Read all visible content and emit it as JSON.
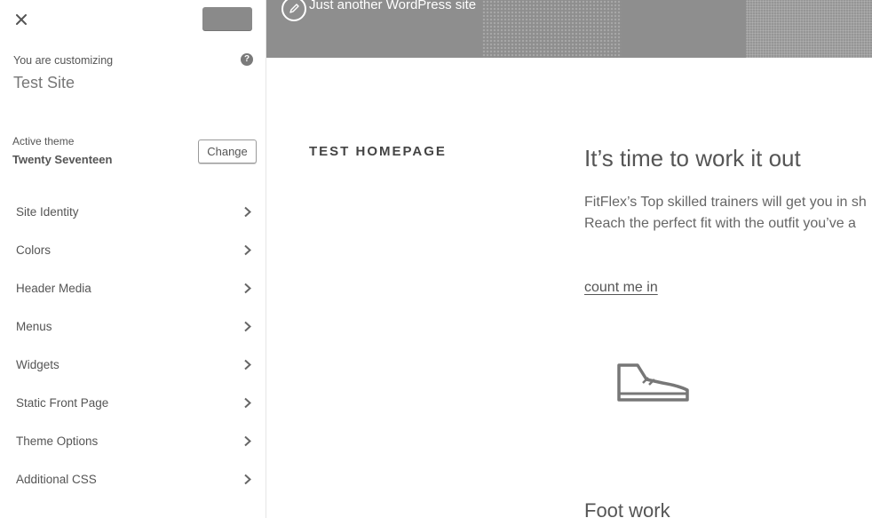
{
  "sidebar": {
    "close_icon": "close-icon",
    "customizing_label": "You are customizing",
    "site_name": "Test Site",
    "help_icon": "help-icon",
    "help_glyph": "?",
    "active_theme_label": "Active theme",
    "active_theme_name": "Twenty Seventeen",
    "change_label": "Change",
    "sections": [
      {
        "label": "Site Identity"
      },
      {
        "label": "Colors"
      },
      {
        "label": "Header Media"
      },
      {
        "label": "Menus"
      },
      {
        "label": "Widgets"
      },
      {
        "label": "Static Front Page"
      },
      {
        "label": "Theme Options"
      },
      {
        "label": "Additional CSS"
      }
    ],
    "chevron_icon": "chevron-right-icon"
  },
  "preview": {
    "tagline": "Just another WordPress site",
    "edit_icon": "pencil-icon",
    "page_title": "TEST HOMEPAGE",
    "headline": "It’s time to work it out",
    "body_line_1": "FitFlex’s Top skilled trainers will get you in sh",
    "body_line_2": "Reach the perfect fit with the outfit you’ve a",
    "cta_link": "count me in",
    "shoe_icon": "shoe-icon",
    "subheading": "Foot work"
  },
  "colors": {
    "header_gray": "#8e8e8e",
    "publish_button": "#8a8a8a",
    "text": "#555555"
  }
}
